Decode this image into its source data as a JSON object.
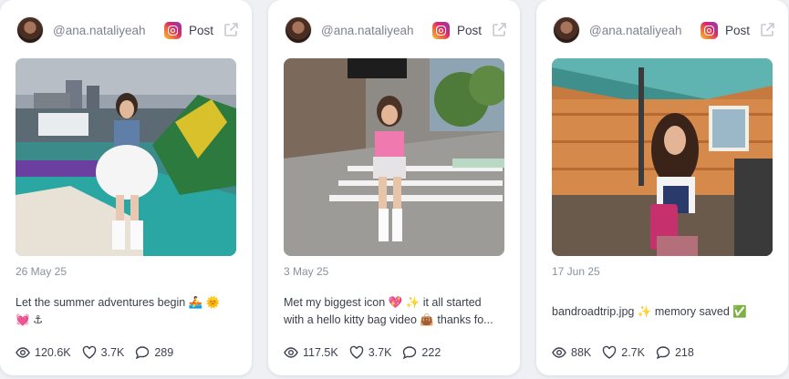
{
  "colors": {
    "card": "#ffffff",
    "background": "#eef0f4",
    "text": "#3b3f4a",
    "muted": "#8b909c"
  },
  "posts": [
    {
      "username": "@ana.nataliyeah",
      "platform_icon": "instagram-icon",
      "type_label": "Post",
      "date": "26 May 25",
      "caption_line1": "Let the summer adventures begin 🚣 🌞",
      "caption_line2": "💓 ⚓",
      "views": "120.6K",
      "likes": "3.7K",
      "comments": "289"
    },
    {
      "username": "@ana.nataliyeah",
      "platform_icon": "instagram-icon",
      "type_label": "Post",
      "date": "3 May 25",
      "caption_line1": "Met my biggest icon 💖 ✨ it all started",
      "caption_line2": "with a hello kitty bag video 👜 thanks fo...",
      "views": "117.5K",
      "likes": "3.7K",
      "comments": "222"
    },
    {
      "username": "@ana.nataliyeah",
      "platform_icon": "instagram-icon",
      "type_label": "Post",
      "date": "17 Jun 25",
      "caption_line1": "bandroadtrip.jpg ✨ memory saved ✅",
      "caption_line2": "",
      "views": "88K",
      "likes": "2.7K",
      "comments": "218"
    }
  ]
}
